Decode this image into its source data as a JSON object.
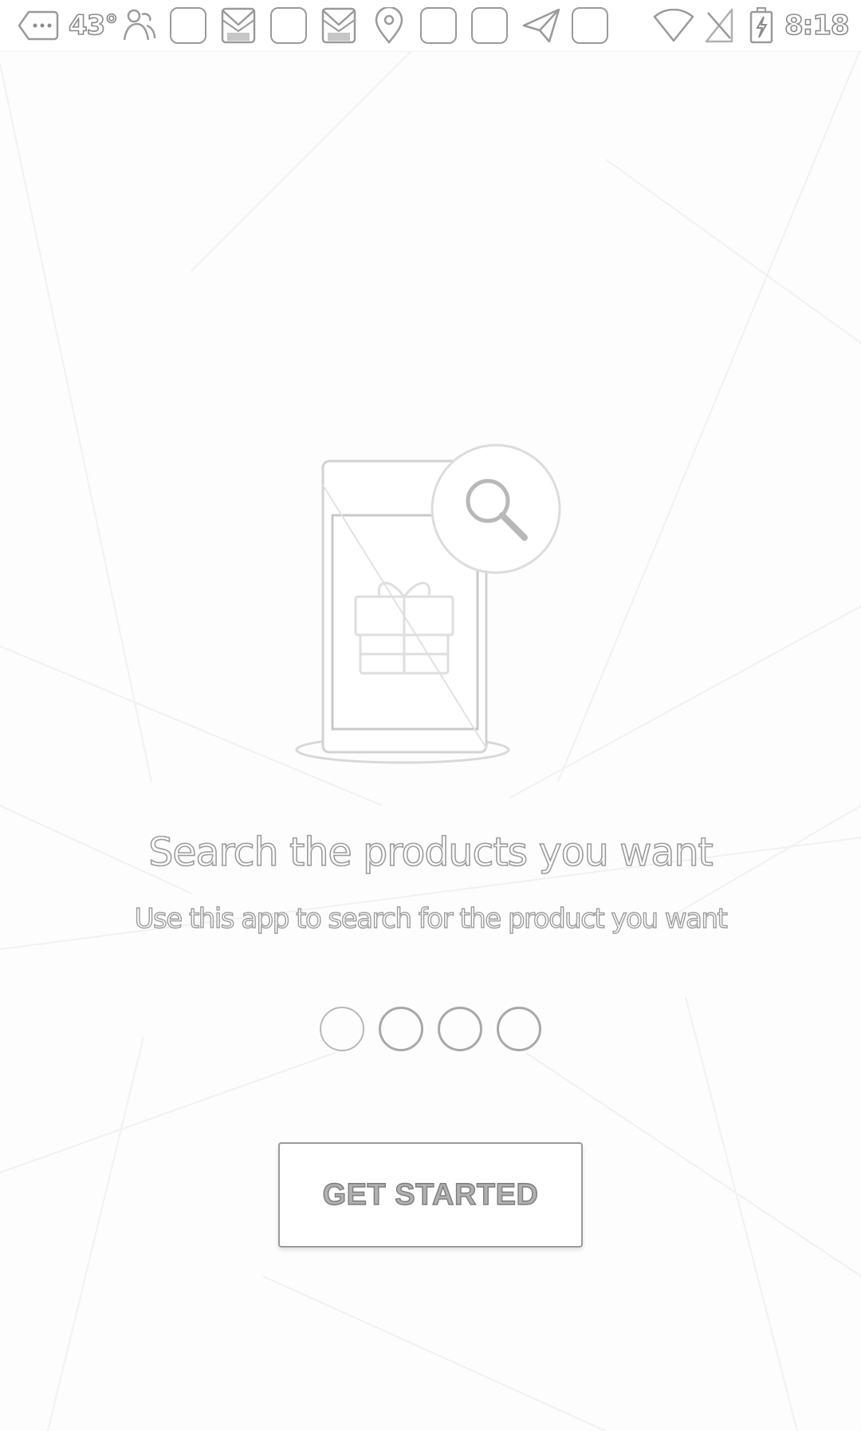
{
  "status_bar": {
    "temperature": "43°",
    "time": "8:18",
    "icons": [
      "more-notifications-icon",
      "temperature",
      "people-icon",
      "app-icon",
      "gift-mail-icon",
      "app-icon",
      "gift-mail-icon",
      "location-pin-icon",
      "app-icon",
      "app-icon",
      "send-icon",
      "app-icon",
      "wifi-icon",
      "no-sim-icon",
      "battery-charging-icon"
    ]
  },
  "onboarding": {
    "illustration": "phone-search-gift-illustration",
    "title": "Search the products you want",
    "subtitle": "Use this app to search for the product you want",
    "page_indicator": {
      "count": 4,
      "active_index": 0
    },
    "cta_label": "GET STARTED"
  }
}
